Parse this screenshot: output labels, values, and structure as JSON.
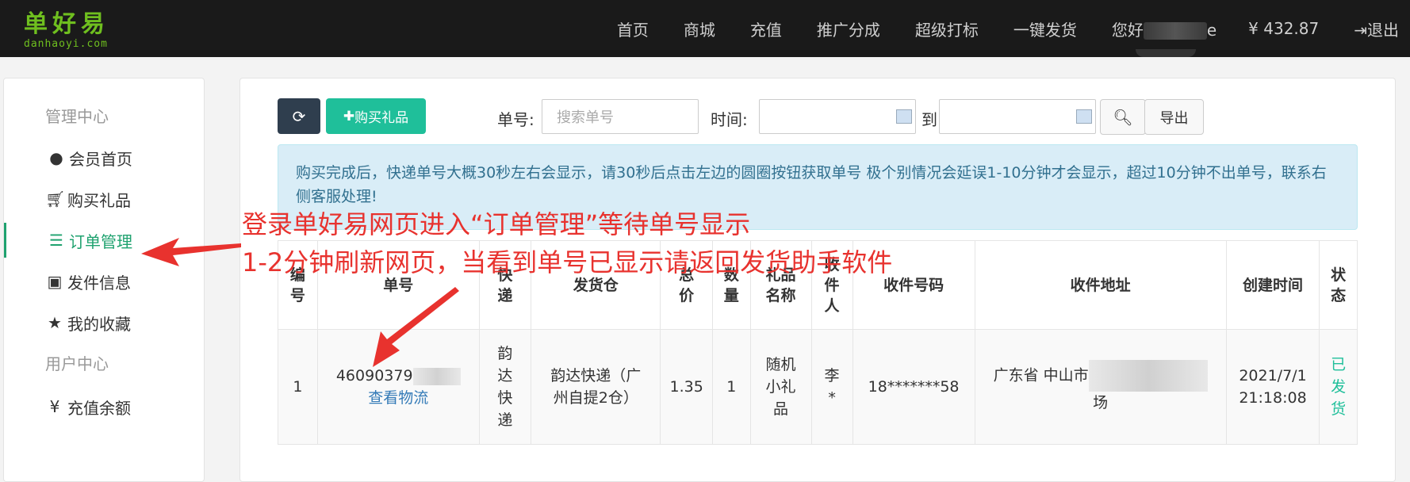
{
  "logo": {
    "cn": "单好易",
    "en": "danhaoyi.com"
  },
  "nav": {
    "items": [
      "首页",
      "商城",
      "充值",
      "推广分成",
      "超级打标",
      "一键发货"
    ],
    "hello_prefix": "您好",
    "hello_suffix": "e",
    "balance": "¥ 432.87",
    "logout": "退出"
  },
  "sidebar": {
    "group1": "管理中心",
    "items": [
      {
        "label": "会员首页",
        "icon": "user-circle-icon"
      },
      {
        "label": "购买礼品",
        "icon": "cart-icon"
      },
      {
        "label": "订单管理",
        "icon": "list-icon"
      },
      {
        "label": "发件信息",
        "icon": "id-card-icon"
      },
      {
        "label": "我的收藏",
        "icon": "star-icon"
      }
    ],
    "group2": "用户中心",
    "items2": [
      {
        "label": "充值余额",
        "icon": "yen-icon"
      }
    ]
  },
  "toolbar": {
    "buy_label": "购买礼品",
    "order_no_label": "单号:",
    "order_no_placeholder": "搜索单号",
    "time_label": "时间:",
    "to_label": "到",
    "export_label": "导出"
  },
  "notice": "购买完成后，快递单号大概30秒左右会显示，请30秒后点击左边的圆圈按钮获取单号 极个别情况会延误1-10分钟才会显示，超过10分钟不出单号，联系右侧客服处理!",
  "table": {
    "headers": [
      "编号",
      "单号",
      "快递",
      "发货仓",
      "总价",
      "数量",
      "礼品名称",
      "收件人",
      "收件号码",
      "收件地址",
      "创建时间",
      "状态"
    ],
    "rows": [
      {
        "id": "1",
        "order_no": "46090379",
        "track_link": "查看物流",
        "courier": "韵达快递",
        "warehouse": "韵达快递（广州自提2仓）",
        "total": "1.35",
        "qty": "1",
        "gift": "随机小礼品",
        "recipient": "李*",
        "phone": "18*******58",
        "address_prefix": "广东省 中山市",
        "address_suffix": "场",
        "created": "2021/7/1 21:18:08",
        "status": "已发货"
      }
    ]
  },
  "annotation": {
    "line1": "登录单好易网页进入“订单管理”等待单号显示",
    "line2": "1-2分钟刷新网页，当看到单号已显示请返回发货助手软件"
  },
  "colors": {
    "accent": "#1fbf9a",
    "nav_bg": "#1a1a1a",
    "logo": "#6fbf1f",
    "annotation": "#e8322e"
  }
}
